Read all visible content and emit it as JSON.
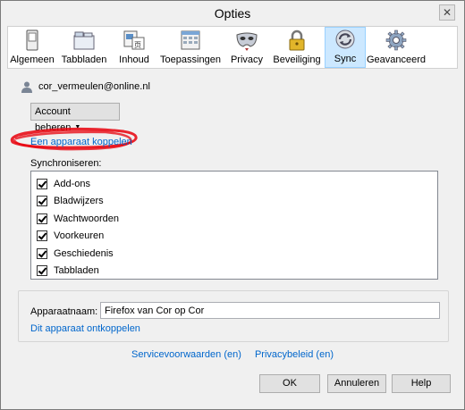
{
  "window": {
    "title": "Opties",
    "close_glyph": "✕"
  },
  "toolbar": {
    "items": [
      {
        "label": "Algemeen",
        "icon": "switch-icon"
      },
      {
        "label": "Tabbladen",
        "icon": "tabs-icon"
      },
      {
        "label": "Inhoud",
        "icon": "content-icon"
      },
      {
        "label": "Toepassingen",
        "icon": "applications-icon"
      },
      {
        "label": "Privacy",
        "icon": "mask-icon"
      },
      {
        "label": "Beveiliging",
        "icon": "padlock-icon"
      },
      {
        "label": "Sync",
        "icon": "sync-icon",
        "active": true
      },
      {
        "label": "Geavanceerd",
        "icon": "gear-icon"
      }
    ]
  },
  "account": {
    "email": "cor_vermeulen@online.nl",
    "manage_button": "Account beheren",
    "pair_link": "Een apparaat koppelen"
  },
  "sync": {
    "label": "Synchroniseren:",
    "items": [
      {
        "label": "Add-ons",
        "checked": true
      },
      {
        "label": "Bladwijzers",
        "checked": true
      },
      {
        "label": "Wachtwoorden",
        "checked": true
      },
      {
        "label": "Voorkeuren",
        "checked": true
      },
      {
        "label": "Geschiedenis",
        "checked": true
      },
      {
        "label": "Tabbladen",
        "checked": true
      }
    ]
  },
  "device": {
    "label": "Apparaatnaam:",
    "value": "Firefox van Cor op Cor",
    "unlink_link": "Dit apparaat ontkoppelen"
  },
  "footer": {
    "terms_link": "Servicevoorwaarden (en)",
    "privacy_link": "Privacybeleid (en)"
  },
  "buttons": {
    "ok": "OK",
    "cancel": "Annuleren",
    "help": "Help"
  },
  "colors": {
    "link": "#0066cc",
    "active_tab": "#cce8ff",
    "annotation": "#e8000b"
  }
}
